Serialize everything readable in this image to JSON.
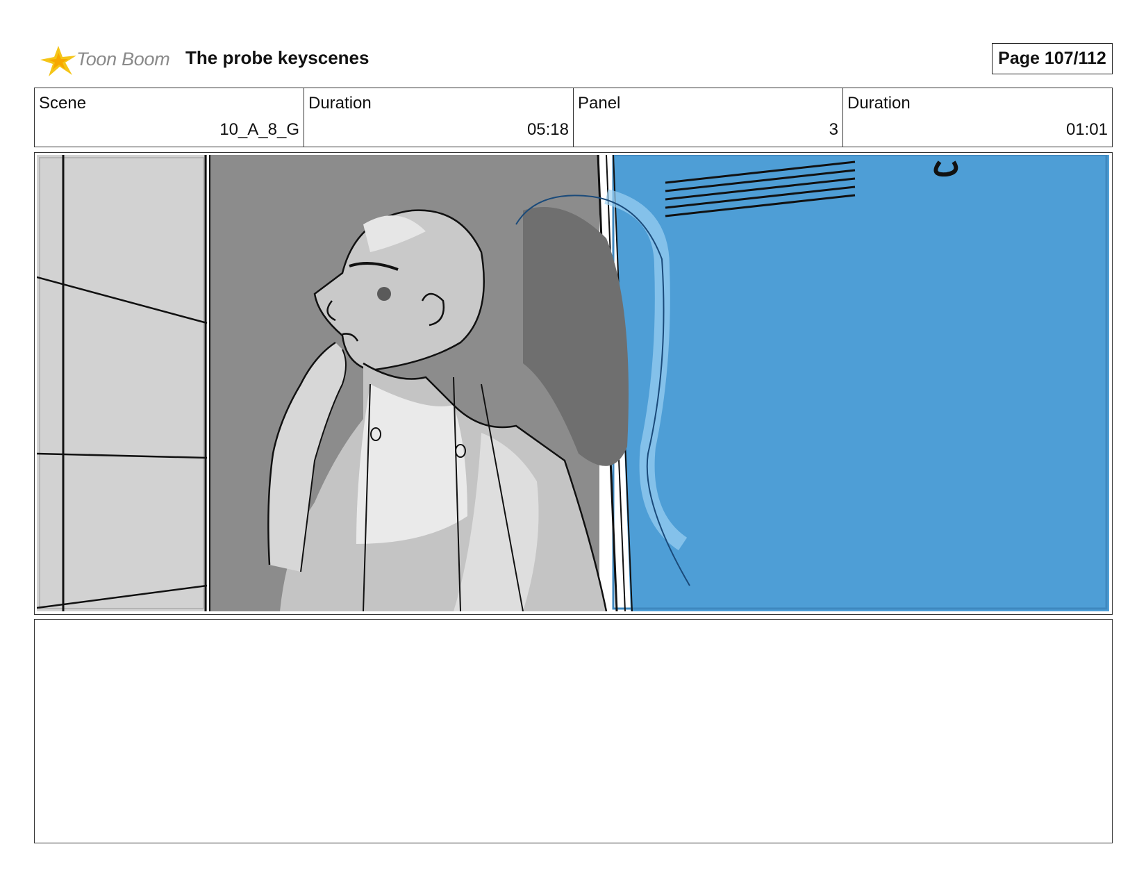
{
  "header": {
    "brand": "Toon Boom",
    "title": "The probe keyscenes",
    "page_label": "Page 107/112"
  },
  "info": {
    "scene_label": "Scene",
    "scene_value": "10_A_8_G",
    "scene_duration_label": "Duration",
    "scene_duration_value": "05:18",
    "panel_label": "Panel",
    "panel_value": "3",
    "panel_duration_label": "Duration",
    "panel_duration_value": "01:01"
  },
  "colors": {
    "sky_blue": "#4e9ed6",
    "wall_gray": "#d0d0d0",
    "doorway_gray": "#8a8a8a",
    "logo_yellow": "#f5c518"
  },
  "notes": {
    "text": ""
  }
}
